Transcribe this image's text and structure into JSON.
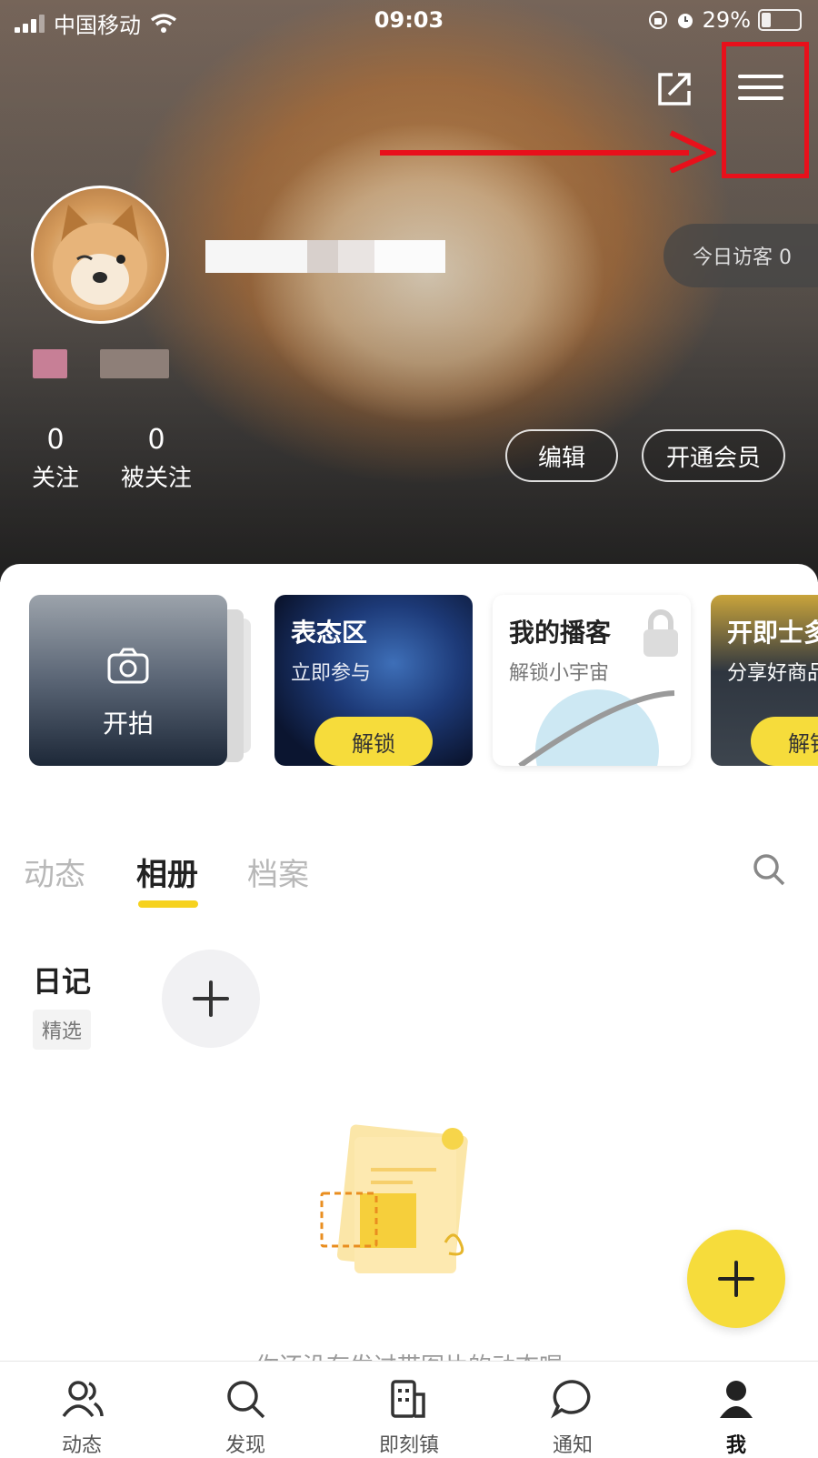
{
  "status_bar": {
    "carrier": "中国移动",
    "time": "09:03",
    "battery": "29%",
    "battery_level": 0.29
  },
  "header": {
    "share_icon": "share-icon",
    "menu_icon": "menu-icon"
  },
  "profile": {
    "visitor_label": "今日访客 0",
    "following_count": "0",
    "following_label": "关注",
    "followers_count": "0",
    "followers_label": "被关注",
    "edit_label": "编辑",
    "vip_label": "开通会员"
  },
  "cards": [
    {
      "title": "开拍",
      "icon": "camera-icon"
    },
    {
      "title": "表态区",
      "subtitle": "立即参与",
      "button": "解锁"
    },
    {
      "title": "我的播客",
      "subtitle": "解锁小宇宙",
      "icon": "lock-icon"
    },
    {
      "title": "开即士多",
      "subtitle": "分享好商品",
      "button": "解锁"
    }
  ],
  "tabs": [
    "动态",
    "相册",
    "档案"
  ],
  "active_tab": "相册",
  "album": {
    "title": "日记",
    "chip": "精选"
  },
  "empty_text": "你还没有发过带图片的动态喔",
  "bottom_nav": [
    {
      "label": "动态",
      "icon": "people-icon"
    },
    {
      "label": "发现",
      "icon": "search-icon"
    },
    {
      "label": "即刻镇",
      "icon": "building-icon"
    },
    {
      "label": "通知",
      "icon": "chat-bubble-icon"
    },
    {
      "label": "我",
      "icon": "person-icon"
    }
  ],
  "colors": {
    "accent": "#f6dc3b",
    "highlight": "#e8101b"
  }
}
